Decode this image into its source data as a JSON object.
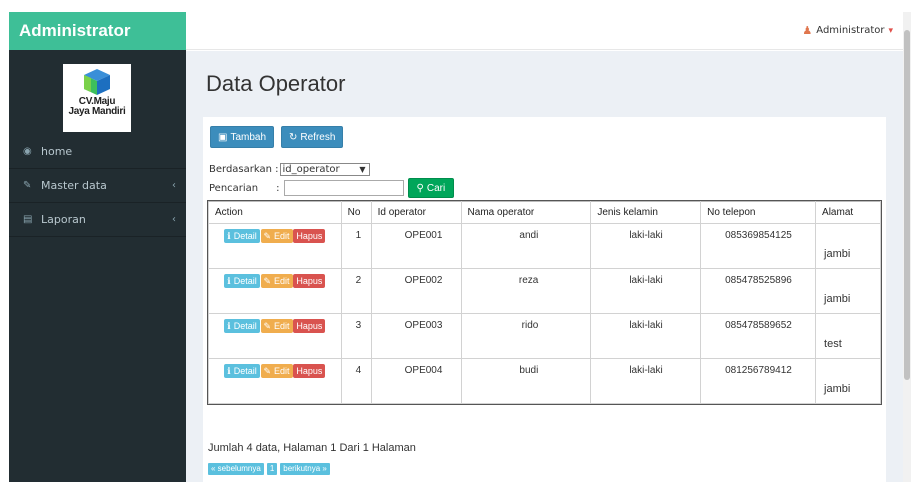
{
  "brand": {
    "title": "Administrator"
  },
  "topbar": {
    "user_label": "Administrator",
    "user_icon": "user-icon",
    "caret_icon": "caret-down-icon"
  },
  "logo": {
    "line1": "CV.Maju",
    "line2": "Jaya Mandiri"
  },
  "sidebar": {
    "items": [
      {
        "label": "home",
        "icon": "dashboard-icon"
      },
      {
        "label": "Master data",
        "icon": "edit-icon"
      },
      {
        "label": "Laporan",
        "icon": "sitemap-icon"
      }
    ]
  },
  "page": {
    "title": "Data Operator"
  },
  "toolbar": {
    "tambah_label": "Tambah",
    "refresh_label": "Refresh"
  },
  "filter": {
    "by_label": "Berdasarkan :",
    "by_value": "id_operator",
    "search_label": "Pencarian",
    "search_sep": ":",
    "search_value": "",
    "search_button": "Cari"
  },
  "table": {
    "columns": [
      "Action",
      "No",
      "Id operator",
      "Nama operator",
      "Jenis kelamin",
      "No telepon",
      "Alamat"
    ],
    "actions": {
      "detail": "Detail",
      "edit": "Edit",
      "hapus": "Hapus"
    },
    "rows": [
      {
        "no": "1",
        "id": "OPE001",
        "nama": "andi",
        "jk": "laki-laki",
        "tel": "085369854125",
        "alamat": "jambi"
      },
      {
        "no": "2",
        "id": "OPE002",
        "nama": "reza",
        "jk": "laki-laki",
        "tel": "085478525896",
        "alamat": "jambi"
      },
      {
        "no": "3",
        "id": "OPE003",
        "nama": "rido",
        "jk": "laki-laki",
        "tel": "085478589652",
        "alamat": "test"
      },
      {
        "no": "4",
        "id": "OPE004",
        "nama": "budi",
        "jk": "laki-laki",
        "tel": "081256789412",
        "alamat": "jambi"
      }
    ]
  },
  "footer": {
    "summary": "Jumlah 4 data, Halaman 1 Dari 1 Halaman",
    "prev": "« sebelumnya",
    "page": "1",
    "next": "berikutnya »"
  },
  "colors": {
    "brand": "#3ebf97",
    "sidebar": "#222d32",
    "primary": "#3c8dbc",
    "success": "#00a65a",
    "info": "#5bc0de",
    "warning": "#f0ad4e",
    "danger": "#d9534f"
  }
}
